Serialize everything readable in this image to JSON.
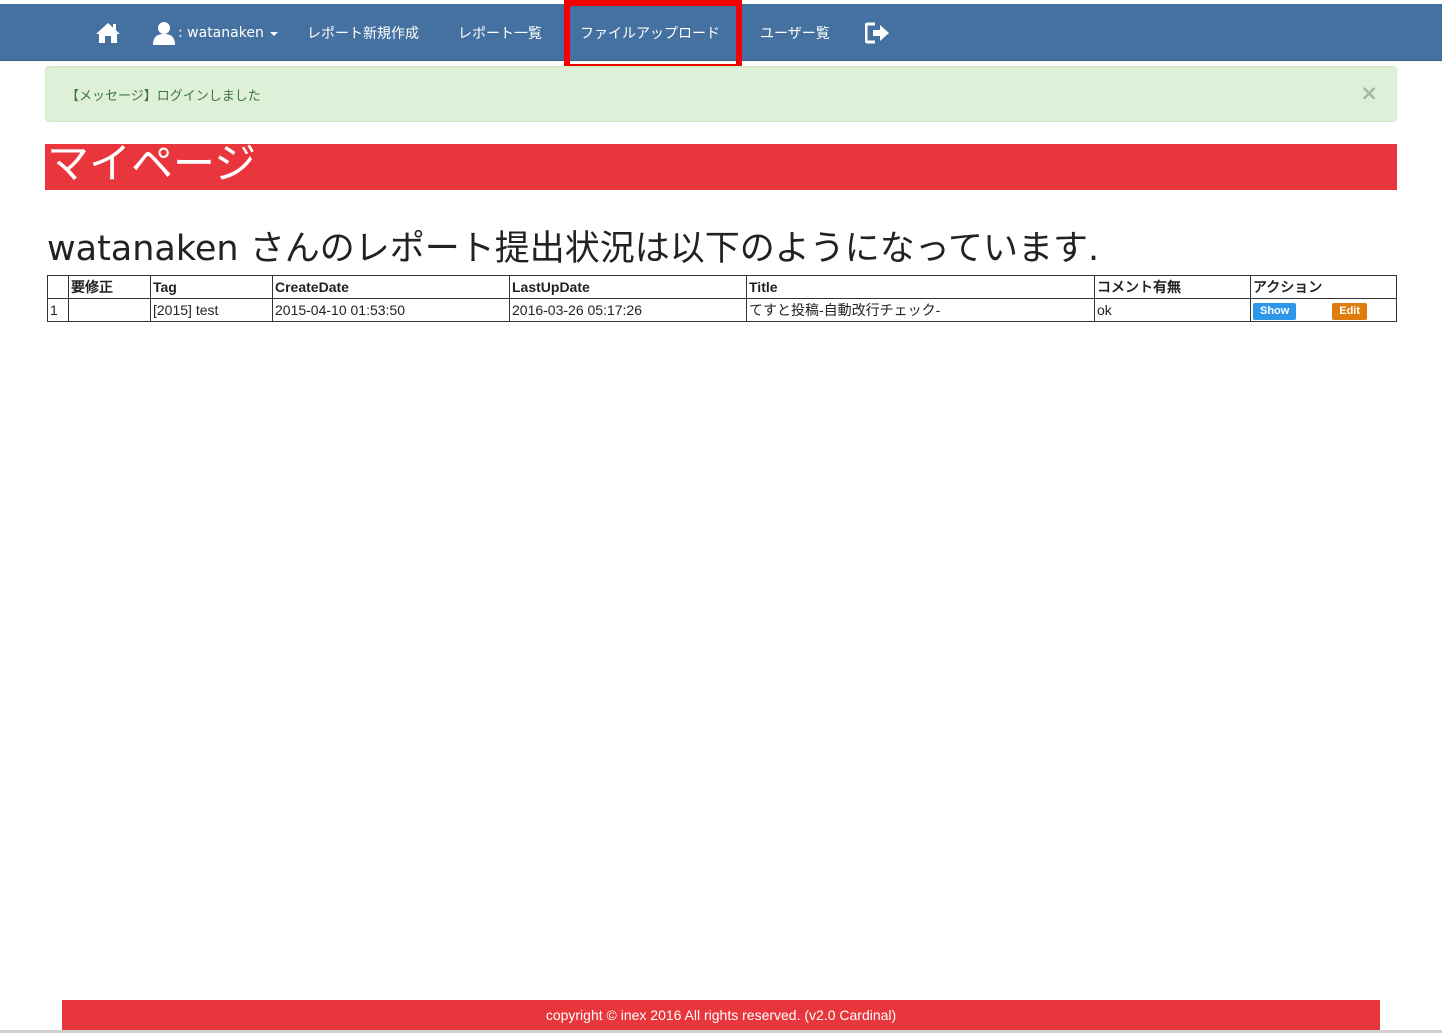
{
  "navbar": {
    "home_icon": "home-icon",
    "user_icon": "user-icon",
    "user_label": ": watanaken",
    "new_report": "レポート新規作成",
    "report_list": "レポート一覧",
    "file_upload": "ファイルアップロード",
    "user_list": "ユーザー覧",
    "logout_icon": "sign-out-icon",
    "bg_color": "#44719f",
    "highlight_color": "#f40000"
  },
  "alert": {
    "message": "【メッセージ】ログインしました",
    "close": "×"
  },
  "page": {
    "title": "マイページ",
    "status_heading": "watanaken さんのレポート提出状況は以下のようになっています.",
    "accent_color": "#e9363d"
  },
  "table": {
    "headers": [
      "",
      "要修正",
      "Tag",
      "CreateDate",
      "LastUpDate",
      "Title",
      "コメント有無",
      "アクション"
    ],
    "rows": [
      {
        "no": "1",
        "needs_fix": "",
        "tag": "[2015] test",
        "create_date": "2015-04-10 01:53:50",
        "last_update": "2016-03-26 05:17:26",
        "title": "てすと投稿-自動改行チェック-",
        "comment": "ok",
        "show_label": "Show",
        "edit_label": "Edit"
      }
    ]
  },
  "footer": {
    "text": "copyright © inex 2016 All rights reserved. (v2.0 Cardinal)"
  }
}
